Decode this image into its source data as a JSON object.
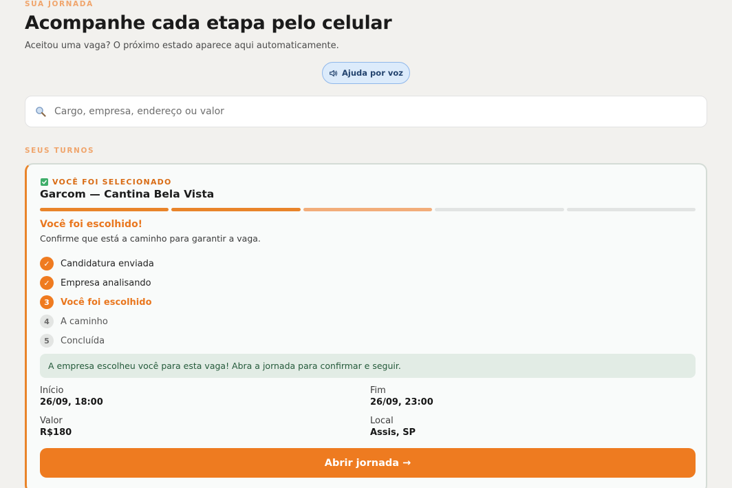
{
  "header": {
    "eyebrow": "SUA JORNADA",
    "title": "Acompanhe cada etapa pelo celular",
    "subtitle": "Aceitou uma vaga? O próximo estado aparece aqui automaticamente.",
    "voice_button_label": "Ajuda por voz"
  },
  "search": {
    "placeholder": "Cargo, empresa, endereço ou valor",
    "value": ""
  },
  "section_label": "SEUS TURNOS",
  "shift_card": {
    "status": "VOCÊ FOI SELECIONADO",
    "job_title": "Garcom — Cantina Bela Vista",
    "progress_segments": [
      {
        "state": "done",
        "color": "#e9842a"
      },
      {
        "state": "done",
        "color": "#e9842a"
      },
      {
        "state": "current",
        "color": "#f2ad7a"
      },
      {
        "state": "pending",
        "color": "#e2e4e3"
      },
      {
        "state": "pending",
        "color": "#e2e4e3"
      }
    ],
    "current_step_title": "Você foi escolhido!",
    "current_step_description": "Confirme que está a caminho para garantir a vaga.",
    "steps": [
      {
        "badge": "✓",
        "label": "Candidatura enviada",
        "state": "done"
      },
      {
        "badge": "✓",
        "label": "Empresa analisando",
        "state": "done"
      },
      {
        "badge": "3",
        "label": "Você foi escolhido",
        "state": "current"
      },
      {
        "badge": "4",
        "label": "A caminho",
        "state": "pending"
      },
      {
        "badge": "5",
        "label": "Concluída",
        "state": "pending"
      }
    ],
    "notice": "A empresa escolheu você para esta vaga! Abra a jornada para confirmar e seguir.",
    "details": {
      "start_label": "Início",
      "start_value": "26/09, 18:00",
      "end_label": "Fim",
      "end_value": "26/09, 23:00",
      "value_label": "Valor",
      "value_value": "R$180",
      "location_label": "Local",
      "location_value": "Assis, SP"
    },
    "open_button_label": "Abrir jornada →"
  },
  "colors": {
    "accent": "#ee7b20",
    "eyebrow": "#f0a56c",
    "notice_bg": "#e2ece5",
    "voice_bg": "#dcebfb"
  },
  "icons": {
    "voice": "speaker-icon",
    "search": "magnifier-icon",
    "status": "check-square-icon"
  }
}
